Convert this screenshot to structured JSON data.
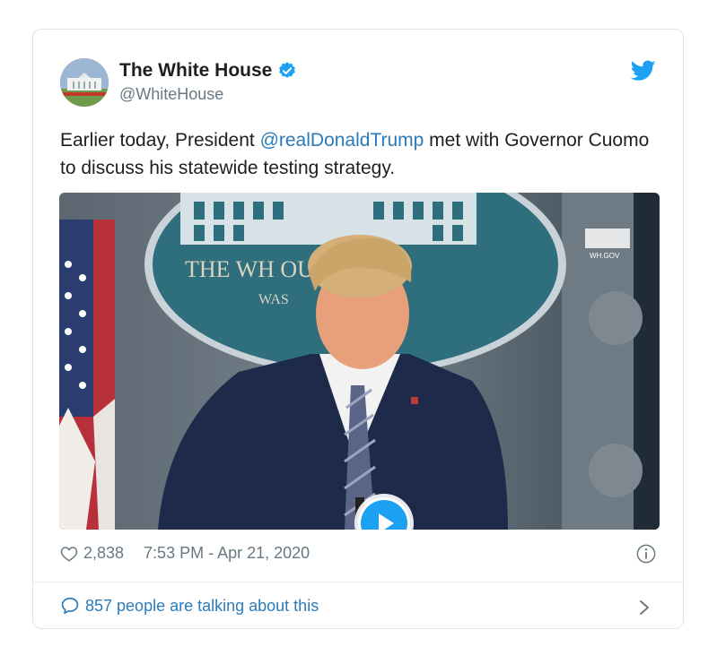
{
  "author": {
    "name": "The White House",
    "handle": "@WhiteHouse"
  },
  "tweet": {
    "text_before": "Earlier today, President ",
    "mention": "@realDonaldTrump",
    "text_after": " met with Governor Cuomo to discuss his statewide testing strategy."
  },
  "media": {
    "backdrop_text": "THE WH          OUSE",
    "backdrop_subtext": "WAS",
    "watermark": "WH.GOV"
  },
  "footer": {
    "likes": "2,838",
    "timestamp": "7:53 PM - Apr 21, 2020",
    "talking": "857 people are talking about this"
  },
  "colors": {
    "accent": "#1da1f2",
    "link": "#2b7bb9",
    "muted": "#697882"
  },
  "icons": [
    "verified-badge-icon",
    "twitter-bird-icon",
    "play-icon",
    "heart-icon",
    "info-icon",
    "speech-bubble-icon",
    "chevron-right-icon"
  ]
}
